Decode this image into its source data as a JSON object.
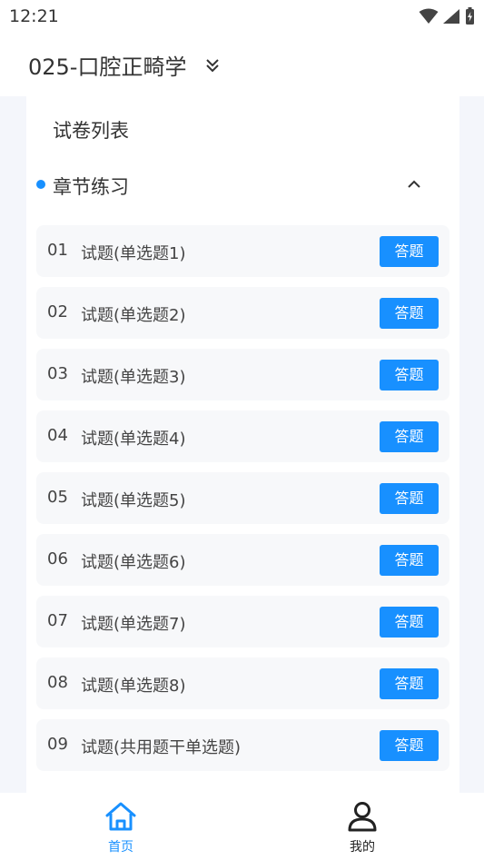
{
  "status_bar": {
    "time": "12:21"
  },
  "header": {
    "course_title": "025-口腔正畸学"
  },
  "panel": {
    "title": "试卷列表",
    "section": {
      "label": "章节练习"
    },
    "items": [
      {
        "num": "01",
        "name": "试题(单选题1)",
        "button": "答题"
      },
      {
        "num": "02",
        "name": "试题(单选题2)",
        "button": "答题"
      },
      {
        "num": "03",
        "name": "试题(单选题3)",
        "button": "答题"
      },
      {
        "num": "04",
        "name": "试题(单选题4)",
        "button": "答题"
      },
      {
        "num": "05",
        "name": "试题(单选题5)",
        "button": "答题"
      },
      {
        "num": "06",
        "name": "试题(单选题6)",
        "button": "答题"
      },
      {
        "num": "07",
        "name": "试题(单选题7)",
        "button": "答题"
      },
      {
        "num": "08",
        "name": "试题(单选题8)",
        "button": "答题"
      },
      {
        "num": "09",
        "name": "试题(共用题干单选题)",
        "button": "答题"
      }
    ]
  },
  "bottom_nav": {
    "home": {
      "label": "首页",
      "icon": "home-icon",
      "active": true
    },
    "mine": {
      "label": "我的",
      "icon": "user-icon",
      "active": false
    }
  },
  "colors": {
    "accent": "#1890ff",
    "text": "#333333",
    "item_bg": "#f7f8fa",
    "content_bg": "#f4f6fb"
  }
}
